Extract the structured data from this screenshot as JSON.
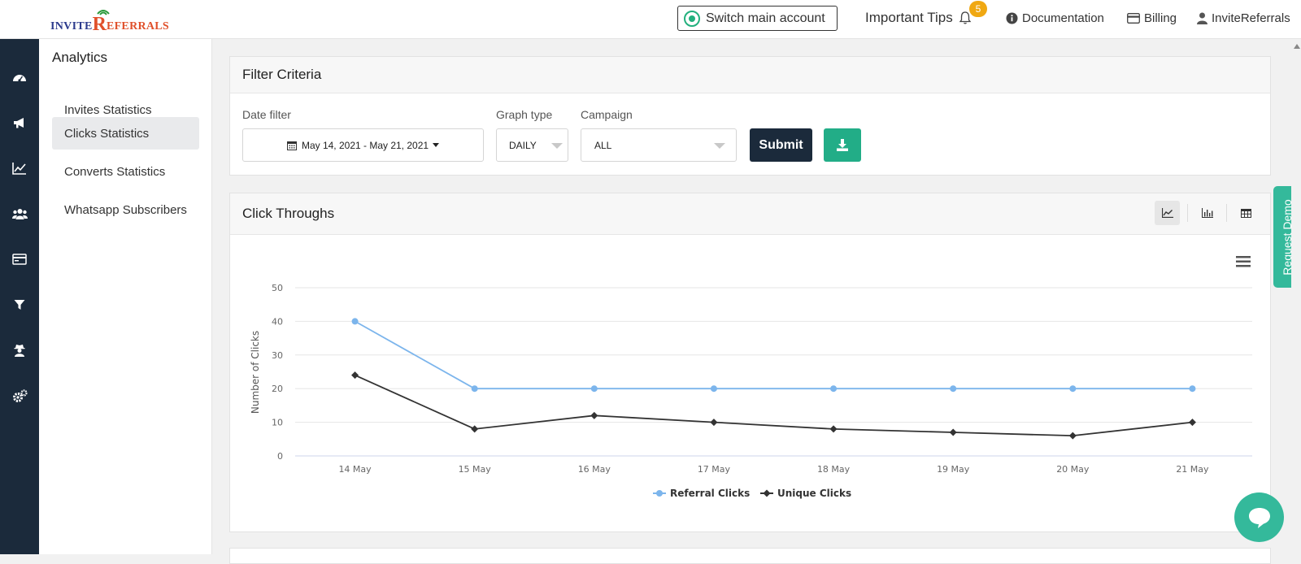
{
  "header": {
    "logo": {
      "part1": "INVITE",
      "part2": "R",
      "part3": "EFERRALS"
    },
    "switch_account": "Switch main account",
    "important_tips": "Important Tips",
    "tips_count": "5",
    "documentation": "Documentation",
    "billing": "Billing",
    "account": "InviteReferrals"
  },
  "sidebar_icons": [
    "dashboard-icon",
    "megaphone-icon",
    "line-chart-icon",
    "users-icon",
    "card-icon",
    "filter-icon",
    "user-secret-icon",
    "cogs-icon"
  ],
  "subnav": {
    "title": "Analytics",
    "items": [
      {
        "label": "Invites Statistics",
        "active": false
      },
      {
        "label": "Clicks Statistics",
        "active": true
      },
      {
        "label": "Converts Statistics",
        "active": false
      },
      {
        "label": "Whatsapp Subscribers",
        "active": false
      }
    ]
  },
  "filter": {
    "title": "Filter Criteria",
    "date_label": "Date filter",
    "date_value": "May 14, 2021 - May 21, 2021",
    "graph_type_label": "Graph type",
    "graph_type_value": "DAILY",
    "campaign_label": "Campaign",
    "campaign_value": "ALL",
    "submit_label": "Submit"
  },
  "click_panel": {
    "title": "Click Throughs",
    "views": [
      "line-chart-view-icon",
      "bar-chart-view-icon",
      "table-view-icon"
    ],
    "active_view": 0
  },
  "chart_data": {
    "type": "line",
    "categories": [
      "14 May",
      "15 May",
      "16 May",
      "17 May",
      "18 May",
      "19 May",
      "20 May",
      "21 May"
    ],
    "ylabel": "Number of Clicks",
    "ylim": [
      0,
      50
    ],
    "yticks": [
      0,
      10,
      20,
      30,
      40,
      50
    ],
    "grid": true,
    "legend": "bottom-center",
    "series": [
      {
        "name": "Referral Clicks",
        "color": "#7cb5ec",
        "marker": "circle",
        "values": [
          40,
          20,
          20,
          20,
          20,
          20,
          20,
          20
        ]
      },
      {
        "name": "Unique Clicks",
        "color": "#333333",
        "marker": "diamond",
        "values": [
          24,
          8,
          12,
          10,
          8,
          7,
          6,
          10
        ]
      }
    ]
  },
  "side_tab": {
    "label": "Request Demo"
  },
  "colors": {
    "sidebar": "#1b2a3b",
    "accent_green": "#22ad87",
    "badge": "#f0a812"
  }
}
